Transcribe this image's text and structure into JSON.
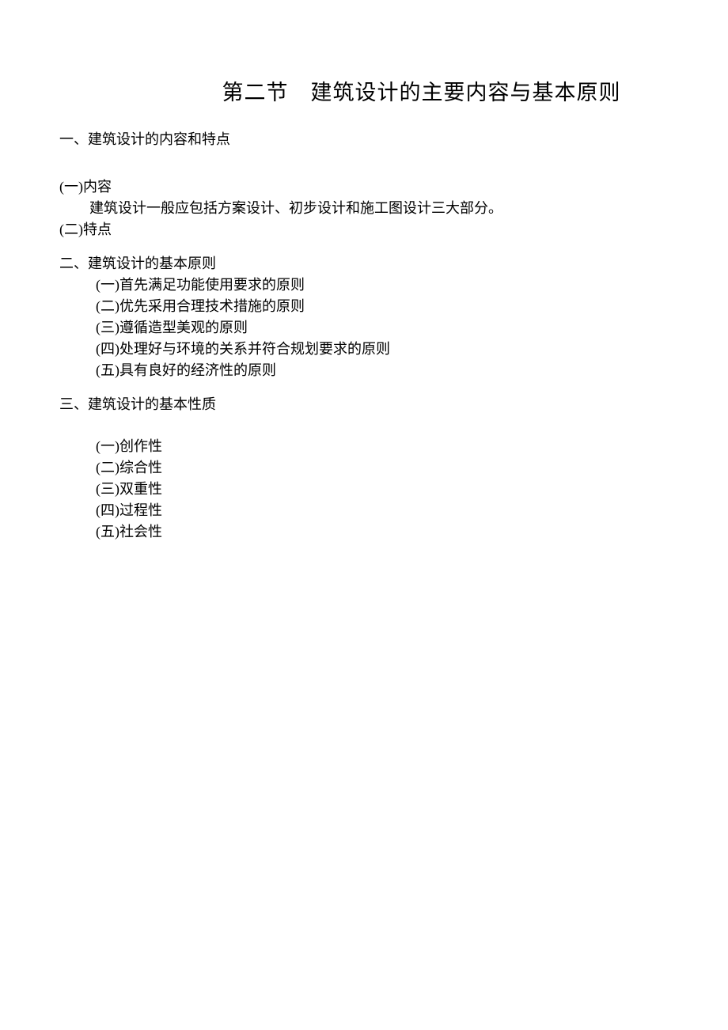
{
  "title": "第二节　建筑设计的主要内容与基本原则",
  "section1": {
    "heading": "一、建筑设计的内容和特点",
    "sub1": "(一)内容",
    "body1": "建筑设计一般应包括方案设计、初步设计和施工图设计三大部分。",
    "sub2": "(二)特点"
  },
  "section2": {
    "heading": "二、建筑设计的基本原则",
    "items": [
      "(一)首先满足功能使用要求的原则",
      "(二)优先采用合理技术措施的原则",
      "(三)遵循造型美观的原则",
      "(四)处理好与环境的关系并符合规划要求的原则",
      "(五)具有良好的经济性的原则"
    ]
  },
  "section3": {
    "heading": "三、建筑设计的基本性质",
    "items": [
      "(一)创作性",
      "(二)综合性",
      "(三)双重性",
      "(四)过程性",
      "(五)社会性"
    ]
  }
}
